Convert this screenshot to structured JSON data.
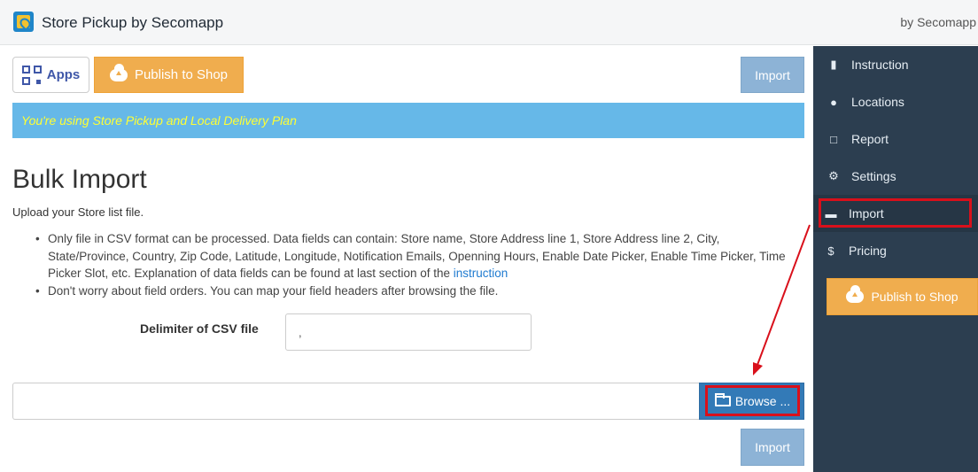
{
  "header": {
    "app_title": "Store Pickup by Secomapp",
    "by_label": "by Secomapp"
  },
  "toolbar": {
    "apps_label": "Apps",
    "publish_label": "Publish to Shop",
    "import_label": "Import"
  },
  "banner": {
    "text": "You're using Store Pickup and Local Delivery Plan"
  },
  "page": {
    "title": "Bulk Import",
    "subtitle": "Upload your Store list file.",
    "note1": "Only file in CSV format can be processed. Data fields can contain: Store name, Store Address line 1, Store Address line 2, City, State/Province, Country, Zip Code, Latitude, Longitude, Notification Emails, Openning Hours, Enable Date Picker, Enable Time Picker, Time Picker Slot, etc. Explanation of data fields can be found at last section of the ",
    "note1_link": "instruction",
    "note2": "Don't worry about field orders. You can map your field headers after browsing the file.",
    "delimiter_label": "Delimiter of CSV file",
    "delimiter_value": ",",
    "browse_label": "Browse ...",
    "import_label": "Import"
  },
  "sidebar": {
    "items": [
      {
        "label": "Instruction",
        "icon": "book-icon"
      },
      {
        "label": "Locations",
        "icon": "map-pin-icon"
      },
      {
        "label": "Report",
        "icon": "bar-chart-icon"
      },
      {
        "label": "Settings",
        "icon": "gear-icon"
      },
      {
        "label": "Import",
        "icon": "folder-open-icon"
      },
      {
        "label": "Pricing",
        "icon": "dollar-icon"
      }
    ],
    "publish_label": "Publish to Shop"
  },
  "colors": {
    "sidebar_bg": "#2c3e50",
    "publish_orange": "#f0ad4e",
    "import_blue_disabled": "#8db3d6",
    "banner_blue": "#66b8e8",
    "banner_text": "#ffff33",
    "browse_blue": "#337ab7",
    "annotation_red": "#d9101b"
  }
}
